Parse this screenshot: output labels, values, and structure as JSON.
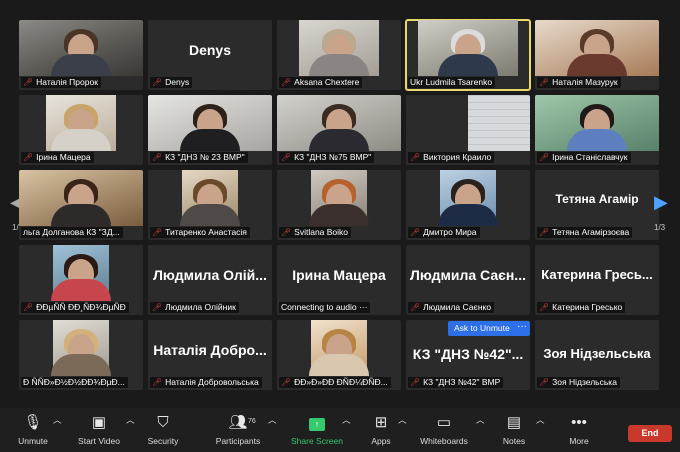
{
  "participants": [
    {
      "name": "Наталія Пророк",
      "video": true,
      "wide": false
    },
    {
      "name": "Denys",
      "display": "Denys",
      "video": false
    },
    {
      "name": "Aksana Chextere",
      "video": true
    },
    {
      "name": "Ukr Ludmila Tsarenko",
      "video": true,
      "active": true
    },
    {
      "name": "Наталія Мазурук",
      "video": true
    },
    {
      "name": "Ірина Мацера",
      "video": true
    },
    {
      "name": "КЗ \"ДНЗ № 23 ВМР\"",
      "video": true
    },
    {
      "name": "КЗ \"ДНЗ №75 ВМР\"",
      "video": true
    },
    {
      "name": "Виктория Краило",
      "video": true
    },
    {
      "name": "Ірина Станіславчук",
      "video": true
    },
    {
      "name": "льга Долганова  КЗ \"ЗД...",
      "video": true
    },
    {
      "name": "Титаренко Анастасія",
      "video": true
    },
    {
      "name": "Svitlana Boiko",
      "video": true
    },
    {
      "name": "Дмитро Мира",
      "video": true
    },
    {
      "name": "Тетяна Агамірзоєва",
      "display": "Тетяна  Агамір",
      "video": false
    },
    {
      "name": "ÐÐµÑÑ ÐÐ¸ÑÐ¾ÐµÑÐ",
      "video": true
    },
    {
      "name": "Людмила Олійник",
      "display": "Людмила  Олій...",
      "video": false
    },
    {
      "name": "Connecting to audio ···",
      "display": "Ірина  Мацера",
      "video": false,
      "nomic": true
    },
    {
      "name": "Людмила Саєнко",
      "display": "Людмила  Саєн...",
      "video": false
    },
    {
      "name": "Катерина Гресько",
      "display": "Катерина  Гресь...",
      "video": false
    },
    {
      "name": "Ð ÑÑÐ»Ð½Ð½ÐÐ¾ÐµÐ...",
      "video": true
    },
    {
      "name": "Наталія Добровольська",
      "display": "Наталія  Добро...",
      "video": false
    },
    {
      "name": "ÐÐ»Ð»ÐÐ ÐÑÐ¼ÐÑÐ...",
      "video": true
    },
    {
      "name": "КЗ \"ДНЗ №42\" ВМР",
      "display": "КЗ  \"ДНЗ  №42\"...",
      "video": false
    },
    {
      "name": "Зоя Нідзельська",
      "display": "Зоя  Нідзельська",
      "video": false
    }
  ],
  "pager": {
    "left": "1/3",
    "right": "1/3"
  },
  "popup": {
    "ask": "Ask to Unmute",
    "more": "···"
  },
  "toolbar": {
    "unmute": "Unmute",
    "start_video": "Start Video",
    "security": "Security",
    "participants": "Participants",
    "participants_count": "76",
    "share": "Share Screen",
    "apps": "Apps",
    "whiteboards": "Whiteboards",
    "notes": "Notes",
    "more": "More",
    "end": "End"
  },
  "colors": {
    "active_border": "#e8d76b",
    "end": "#c8392b",
    "share": "#36c96e",
    "ask": "#2d6fe6"
  }
}
